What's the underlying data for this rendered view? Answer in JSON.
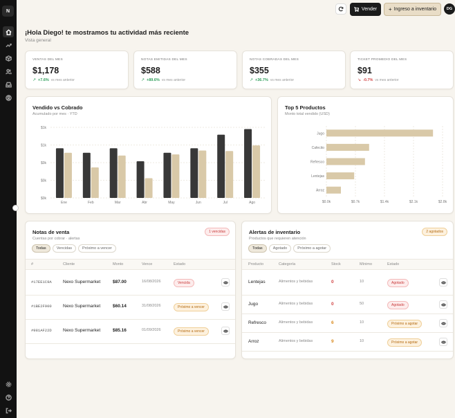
{
  "sidebar": {
    "logo": "N",
    "nav": [
      "home-icon",
      "trending-icon",
      "box-icon",
      "users-icon",
      "inbox-icon",
      "user-circle-icon"
    ],
    "footer": [
      "settings-icon",
      "help-icon",
      "logout-icon"
    ]
  },
  "topbar": {
    "sell_label": "Vender",
    "inventory_label": "Ingreso a inventario",
    "avatar_initials": "DG"
  },
  "header": {
    "greeting": "¡Hola Diego! te mostramos tu actividad más reciente",
    "subtitle": "Vista general"
  },
  "kpis": [
    {
      "label": "Ventas del mes",
      "value": "$1,178",
      "arrow": "↗",
      "delta": "+7.6%",
      "ref": "vs mes anterior",
      "trend": "up"
    },
    {
      "label": "Notas emitidas del mes",
      "value": "$588",
      "arrow": "↗",
      "delta": "+89.6%",
      "ref": "vs mes anterior",
      "trend": "up"
    },
    {
      "label": "Notas cobradas del mes",
      "value": "$355",
      "arrow": "↗",
      "delta": "+36.7%",
      "ref": "vs mes anterior",
      "trend": "up"
    },
    {
      "label": "Ticket promedio del mes",
      "value": "$91",
      "arrow": "↘",
      "delta": "-0.7%",
      "ref": "vs mes anterior",
      "trend": "down"
    }
  ],
  "sold_vs_collected": {
    "title": "Vendido vs Cobrado",
    "subtitle": "Acumulado por mes · YTD"
  },
  "top_products": {
    "title": "Top 5 Productos",
    "subtitle": "Monto total vendido (USD)"
  },
  "chart_data": [
    {
      "type": "bar",
      "title": "Vendido vs Cobrado",
      "categories": [
        "Ene",
        "Feb",
        "Mar",
        "Abr",
        "May",
        "Jun",
        "Jul",
        "Ago"
      ],
      "yticks": [
        "$0k",
        "$0k",
        "$0k",
        "$1k",
        "$1k"
      ],
      "ylim": [
        0,
        1.25
      ],
      "series": [
        {
          "values": [
            0.88,
            0.8,
            0.88,
            0.65,
            0.8,
            0.88,
            1.12,
            1.22
          ],
          "color": "#383838"
        },
        {
          "values": [
            0.8,
            0.54,
            0.75,
            0.35,
            0.77,
            0.84,
            0.83,
            0.93
          ],
          "color": "#d9c9a8"
        }
      ],
      "grid": true
    },
    {
      "type": "bar",
      "orientation": "horizontal",
      "title": "Top 5 Productos",
      "categories": [
        "Jugo",
        "Cafecito",
        "Refresco",
        "Lentejas",
        "Arroz"
      ],
      "values": [
        2.57,
        1.03,
        0.93,
        0.67,
        0.35
      ],
      "xticks": [
        "$0.0k",
        "$0.7k",
        "$1.4k",
        "$2.1k",
        "$2.8k"
      ],
      "xlim": [
        0,
        2.8
      ],
      "color": "#d9c9a8",
      "grid": true
    }
  ],
  "notes": {
    "title": "Notas de venta",
    "subtitle": "Cuentas por cobrar · alertas",
    "badge": "1 vencidas",
    "filters": [
      "Todas",
      "Vencidas",
      "Próximo a vencer"
    ],
    "columns": [
      "#",
      "Cliente",
      "Monto",
      "Vence",
      "Estado"
    ],
    "rows": [
      {
        "id": "#17EE1C9A",
        "client": "Nexo Supermarket",
        "amount": "$87.00",
        "due": "16/08/2026",
        "status": "Vencida",
        "tone": "red"
      },
      {
        "id": "#1BE2F900",
        "client": "Nexo Supermarket",
        "amount": "$60.14",
        "due": "31/08/2026",
        "status": "Próximo a vencer",
        "tone": "orange"
      },
      {
        "id": "#981AF22D",
        "client": "Nexo Supermarket",
        "amount": "$85.16",
        "due": "01/09/2026",
        "status": "Próximo a vencer",
        "tone": "orange"
      }
    ]
  },
  "inventory": {
    "title": "Alertas de inventario",
    "subtitle": "Productos que requieren atención",
    "badge": "2 agotados",
    "filters": [
      "Todas",
      "Agotado",
      "Próximo a agotar"
    ],
    "columns": [
      "Producto",
      "Categoría",
      "Stock",
      "Mínimo",
      "Estado"
    ],
    "rows": [
      {
        "product": "Lentejas",
        "category": "Alimentos y bebidas",
        "stock": "0",
        "min": "10",
        "status": "Agotado",
        "tone": "red"
      },
      {
        "product": "Jugo",
        "category": "Alimentos y bebidas",
        "stock": "0",
        "min": "50",
        "status": "Agotado",
        "tone": "red"
      },
      {
        "product": "Refresco",
        "category": "Alimentos y bebidas",
        "stock": "6",
        "min": "10",
        "status": "Próximo a agotar",
        "tone": "orange"
      },
      {
        "product": "Arroz",
        "category": "Alimentos y bebidas",
        "stock": "9",
        "min": "10",
        "status": "Próximo a agotar",
        "tone": "orange"
      }
    ]
  }
}
